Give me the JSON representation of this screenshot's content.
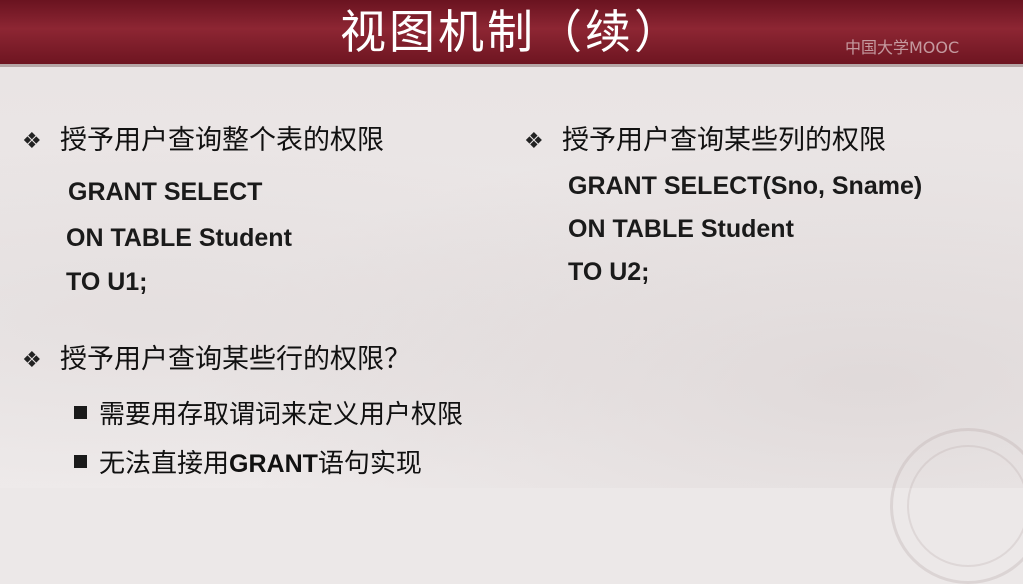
{
  "header": {
    "title": "视图机制（续）",
    "watermark": "中国大学MOOC"
  },
  "left": {
    "heading": "授予用户查询整个表的权限",
    "code": [
      "GRANT SELECT",
      "ON TABLE Student",
      "TO U1;"
    ]
  },
  "right": {
    "heading": "授予用户查询某些列的权限",
    "code": [
      "GRANT SELECT(Sno, Sname)",
      "ON TABLE Student",
      "TO U2;"
    ]
  },
  "rows": {
    "heading": "授予用户查询某些行的权限？",
    "sub1": "需要用存取谓词来定义用户权限",
    "sub2_prefix": "无法直接用",
    "sub2_keyword": "GRANT",
    "sub2_suffix": "语句实现"
  },
  "icons": {
    "bullet": "❖"
  }
}
